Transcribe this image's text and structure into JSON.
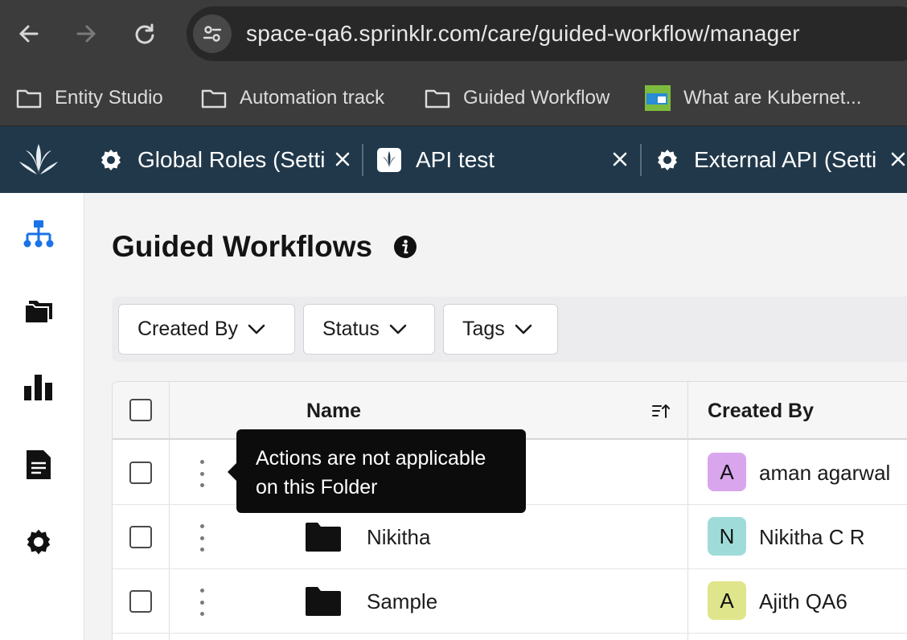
{
  "browser": {
    "url": "space-qa6.sprinklr.com/care/guided-workflow/manager",
    "bookmarks": [
      {
        "label": "Entity Studio",
        "icon": "folder-icon"
      },
      {
        "label": "Automation track",
        "icon": "folder-icon"
      },
      {
        "label": "Guided Workflow",
        "icon": "folder-icon"
      },
      {
        "label": "What are Kubernet...",
        "icon": "kubernetes-favicon"
      }
    ]
  },
  "app_tabs": [
    {
      "label": "Global Roles (Setti",
      "icon": "gear-icon"
    },
    {
      "label": "API test",
      "icon": "workflow-icon"
    },
    {
      "label": "External API (Setti",
      "icon": "gear-icon"
    }
  ],
  "sidebar": {
    "items": [
      {
        "name": "hierarchy-icon",
        "active": true
      },
      {
        "name": "folders-icon",
        "active": false
      },
      {
        "name": "bar-chart-icon",
        "active": false
      },
      {
        "name": "document-icon",
        "active": false
      },
      {
        "name": "settings-icon",
        "active": false
      }
    ]
  },
  "page": {
    "title": "Guided Workflows"
  },
  "filters": [
    {
      "label": "Created By"
    },
    {
      "label": "Status"
    },
    {
      "label": "Tags"
    }
  ],
  "table": {
    "columns": {
      "name": "Name",
      "created_by": "Created By"
    },
    "rows": [
      {
        "name": "",
        "creator": "aman agarwal",
        "initial": "A",
        "avatar_color": "#d9a6ee"
      },
      {
        "name": "Nikitha",
        "creator": "Nikitha C R",
        "initial": "N",
        "avatar_color": "#9fdcd9"
      },
      {
        "name": "Sample",
        "creator": "Ajith QA6",
        "initial": "A",
        "avatar_color": "#dfe58a"
      }
    ]
  },
  "tooltip": {
    "text": "Actions are not applicable on this Folder"
  },
  "colors": {
    "app_header": "#21384a",
    "accent_blue": "#1a73e8",
    "chrome_bg": "#3c3c3c"
  }
}
